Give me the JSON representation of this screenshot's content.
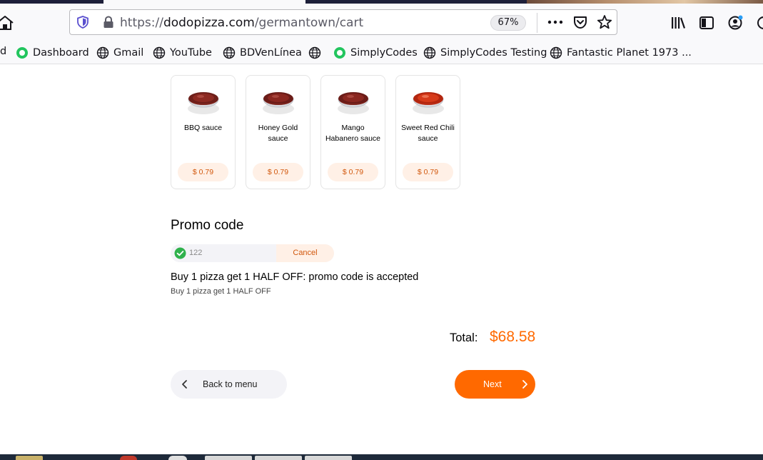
{
  "browser": {
    "url_protocol": "https://",
    "url_host": "dodopizza.com",
    "url_path": "/germantown/cart",
    "zoom": "67%"
  },
  "bookmarks": {
    "cut_item": "d",
    "items": [
      {
        "label": "Dashboard",
        "icon": "green-circle-icon"
      },
      {
        "label": "Gmail",
        "icon": "globe-icon"
      },
      {
        "label": "YouTube",
        "icon": "globe-icon"
      },
      {
        "label": "BDVenLínea",
        "icon": "globe-icon"
      },
      {
        "label": "",
        "icon": "globe-icon"
      },
      {
        "label": "SimplyCodes",
        "icon": "green-circle-icon"
      },
      {
        "label": "SimplyCodes Testing",
        "icon": "globe-icon"
      },
      {
        "label": "Fantastic Planet 1973 ...",
        "icon": "globe-icon"
      }
    ]
  },
  "sauces": [
    {
      "name": "BBQ sauce",
      "price": "$ 0.79"
    },
    {
      "name": "Honey Gold sauce",
      "price": "$ 0.79"
    },
    {
      "name": "Mango Habanero sauce",
      "price": "$ 0.79"
    },
    {
      "name": "Sweet Red Chili sauce",
      "price": "$ 0.79"
    }
  ],
  "promo": {
    "title": "Promo code",
    "code": "122",
    "cancel_label": "Cancel",
    "message": "Buy 1 pizza get 1 HALF OFF: promo code is accepted",
    "description": "Buy 1 pizza get 1 HALF OFF"
  },
  "total": {
    "label": "Total:",
    "value": "$68.58"
  },
  "actions": {
    "back_label": "Back to menu",
    "next_label": "Next"
  },
  "colors": {
    "accent": "#ff6900",
    "price_bg": "#fff0e6",
    "success": "#2fb14c"
  }
}
